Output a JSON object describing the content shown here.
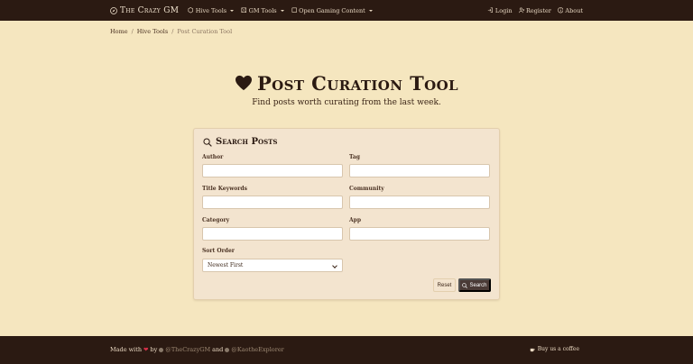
{
  "navbar": {
    "brand": "The Crazy GM",
    "items": [
      {
        "label": "Hive Tools"
      },
      {
        "label": "GM Tools"
      },
      {
        "label": "Open Gaming Content"
      }
    ],
    "right": [
      {
        "label": "Login"
      },
      {
        "label": "Register"
      },
      {
        "label": "About"
      }
    ]
  },
  "breadcrumb": {
    "home": "Home",
    "section": "Hive Tools",
    "current": "Post Curation Tool",
    "separator": "/"
  },
  "hero": {
    "title": "Post Curation Tool",
    "subtitle": "Find posts worth curating from the last week."
  },
  "search_card": {
    "title": "Search Posts",
    "fields": {
      "author": {
        "label": "Author",
        "value": "",
        "placeholder": ""
      },
      "tag": {
        "label": "Tag",
        "value": "",
        "placeholder": ""
      },
      "title_keywords": {
        "label": "Title Keywords",
        "value": "",
        "placeholder": ""
      },
      "community": {
        "label": "Community",
        "value": "",
        "placeholder": ""
      },
      "category": {
        "label": "Category",
        "value": "",
        "placeholder": ""
      },
      "app": {
        "label": "App",
        "value": "",
        "placeholder": ""
      }
    },
    "sort_order": {
      "label": "Sort Order",
      "selected": "Newest First"
    },
    "reset_label": "Reset",
    "search_label": "Search"
  },
  "footer": {
    "made_with": "Made with",
    "by": "by",
    "author1": "@TheCrazyGM",
    "and": "and",
    "author2": "@KaotheExplorer",
    "coffee": "Buy us a coffee"
  },
  "colors": {
    "background": "#f5e6bf",
    "navbar": "#2b1a12",
    "card": "#f3e4cf",
    "search_button": "#4a3a36",
    "heart": "#d9304a"
  }
}
